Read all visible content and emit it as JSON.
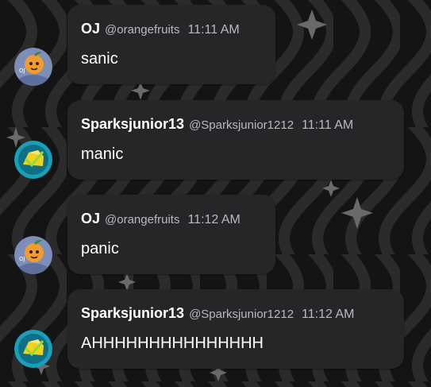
{
  "messages": [
    {
      "author": "OJ",
      "handle": "@orangefruits",
      "time": "11:11 AM",
      "text": "sanic",
      "avatar": "orange-character-avatar"
    },
    {
      "author": "Sparksjunior13",
      "handle": "@Sparksjunior1212",
      "time": "11:11 AM",
      "text": "manic",
      "avatar": "cheese-badge-avatar"
    },
    {
      "author": "OJ",
      "handle": "@orangefruits",
      "time": "11:12 AM",
      "text": "panic",
      "avatar": "orange-character-avatar"
    },
    {
      "author": "Sparksjunior13",
      "handle": "@Sparksjunior1212",
      "time": "11:12 AM",
      "text": "AHHHHHHHHHHHHHHH",
      "avatar": "cheese-badge-avatar"
    }
  ],
  "colors": {
    "background": "#141414",
    "bubble": "#262527",
    "author": "#ffffff",
    "meta": "#b9b9bf",
    "text": "#ffffff"
  }
}
